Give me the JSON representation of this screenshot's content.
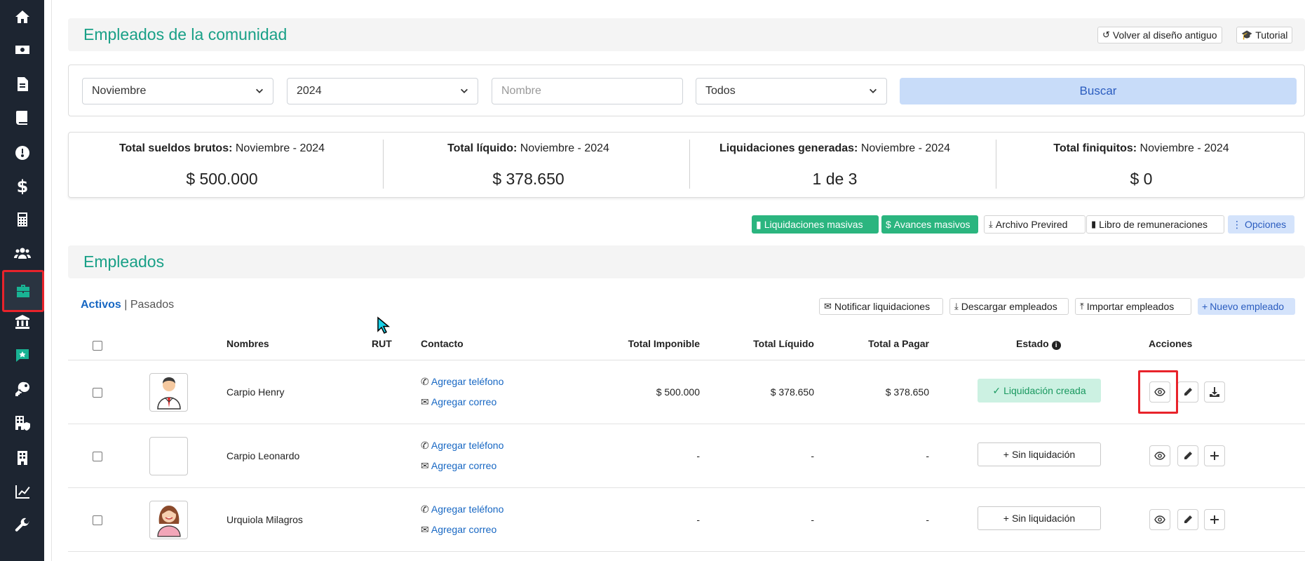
{
  "sidebar": {
    "items": [
      "home-icon",
      "money-icon",
      "document-icon",
      "book-icon",
      "dashboard-icon",
      "dollar-icon",
      "calculator-icon",
      "users-icon",
      "briefcase-icon",
      "bank-icon",
      "chat-icon",
      "key-icon",
      "building-shield-icon",
      "building-icon",
      "chart-icon",
      "wrench-icon"
    ],
    "active": "briefcase-icon",
    "accent": "#19b394"
  },
  "header": {
    "title": "Empleados de la comunidad",
    "old_design_label": "Volver al diseño antiguo",
    "tutorial_label": "Tutorial"
  },
  "filters": {
    "month": "Noviembre",
    "year": "2024",
    "name_placeholder": "Nombre",
    "status": "Todos",
    "search_label": "Buscar"
  },
  "stats": [
    {
      "label": "Total sueldos brutos:",
      "period": "Noviembre - 2024",
      "value": "$ 500.000"
    },
    {
      "label": "Total líquido:",
      "period": "Noviembre - 2024",
      "value": "$ 378.650"
    },
    {
      "label": "Liquidaciones generadas:",
      "period": "Noviembre - 2024",
      "value": "1 de 3"
    },
    {
      "label": "Total finiquitos:",
      "period": "Noviembre - 2024",
      "value": "$ 0"
    }
  ],
  "toolbar": {
    "mass_payroll": "Liquidaciones masivas",
    "mass_advances": "Avances masivos",
    "previred": "Archivo Previred",
    "book": "Libro de remuneraciones",
    "options": "Opciones"
  },
  "employees_section": {
    "title": "Empleados",
    "tab_active": "Activos",
    "separator": "|",
    "tab_past": "Pasados",
    "notify": "Notificar liquidaciones",
    "download": "Descargar empleados",
    "import": "Importar empleados",
    "new": "Nuevo empleado"
  },
  "table": {
    "columns": [
      "Nombres",
      "RUT",
      "Contacto",
      "Total Imponible",
      "Total Líquido",
      "Total a Pagar",
      "Estado",
      "Acciones"
    ],
    "rows": [
      {
        "name": "Carpio Henry",
        "phone": "Agregar teléfono",
        "email": "Agregar correo",
        "imponible": "$ 500.000",
        "liquido": "$ 378.650",
        "pagar": "$ 378.650",
        "status": "Liquidación creada"
      },
      {
        "name": "Carpio Leonardo",
        "phone": "Agregar teléfono",
        "email": "Agregar correo",
        "imponible": "-",
        "liquido": "-",
        "pagar": "-",
        "status": "Sin liquidación"
      },
      {
        "name": "Urquiola Milagros",
        "phone": "Agregar teléfono",
        "email": "Agregar correo",
        "imponible": "-",
        "liquido": "-",
        "pagar": "-",
        "status": "Sin liquidación"
      }
    ]
  }
}
